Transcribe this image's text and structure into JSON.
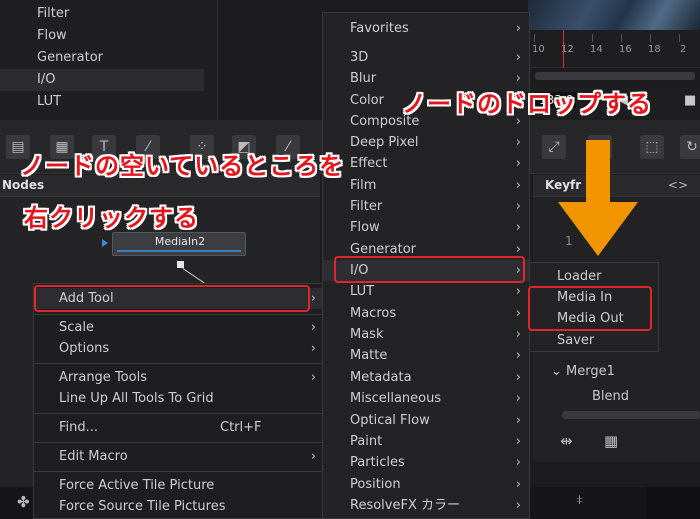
{
  "top_list": {
    "items": [
      {
        "label": "Filter",
        "selected": false
      },
      {
        "label": "Flow",
        "selected": false
      },
      {
        "label": "Generator",
        "selected": false
      },
      {
        "label": "I/O",
        "selected": true
      },
      {
        "label": "LUT",
        "selected": false
      }
    ]
  },
  "ruler": {
    "ticks": [
      "10",
      "12",
      "14",
      "16",
      "18",
      "2"
    ]
  },
  "transport": {
    "timecode": "133.0"
  },
  "nodes_panel": {
    "title": "Nodes",
    "node_label": "MediaIn2"
  },
  "context_menu": {
    "items": [
      {
        "label": "Add Tool",
        "submenu": true,
        "shortcut": ""
      },
      {
        "label": "Scale",
        "submenu": true,
        "shortcut": ""
      },
      {
        "label": "Options",
        "submenu": true,
        "shortcut": ""
      },
      {
        "label": "Arrange Tools",
        "submenu": true,
        "shortcut": ""
      },
      {
        "label": "Line Up All Tools To Grid",
        "submenu": false,
        "shortcut": ""
      },
      {
        "label": "Find...",
        "submenu": false,
        "shortcut": "Ctrl+F"
      },
      {
        "label": "Edit Macro",
        "submenu": true,
        "shortcut": ""
      },
      {
        "label": "Force Active Tile Picture",
        "submenu": false,
        "shortcut": ""
      },
      {
        "label": "Force Source Tile Pictures",
        "submenu": false,
        "shortcut": ""
      }
    ]
  },
  "category_menu": {
    "items": [
      "Favorites",
      "3D",
      "Blur",
      "Color",
      "Composite",
      "Deep Pixel",
      "Effect",
      "Film",
      "Filter",
      "Flow",
      "Generator",
      "I/O",
      "LUT",
      "Macros",
      "Mask",
      "Matte",
      "Metadata",
      "Miscellaneous",
      "Optical Flow",
      "Paint",
      "Particles",
      "Position",
      "ResolveFX カラー"
    ],
    "selected": "I/O"
  },
  "io_menu": {
    "items": [
      "Loader",
      "Media In",
      "Media Out",
      "Saver"
    ]
  },
  "keyframes": {
    "title": "Keyfr",
    "expand_icon": "<>",
    "ghost_label": "1",
    "merge_label": "Merge1",
    "blend_label": "Blend"
  },
  "annotations": {
    "note_right_click_line1": "ノードの空いているところを",
    "note_right_click_line2": "右クリックする",
    "note_drop_node": "ノードのドロップする",
    "highlight_color": "#e0262a",
    "arrow_color": "#f29400"
  }
}
